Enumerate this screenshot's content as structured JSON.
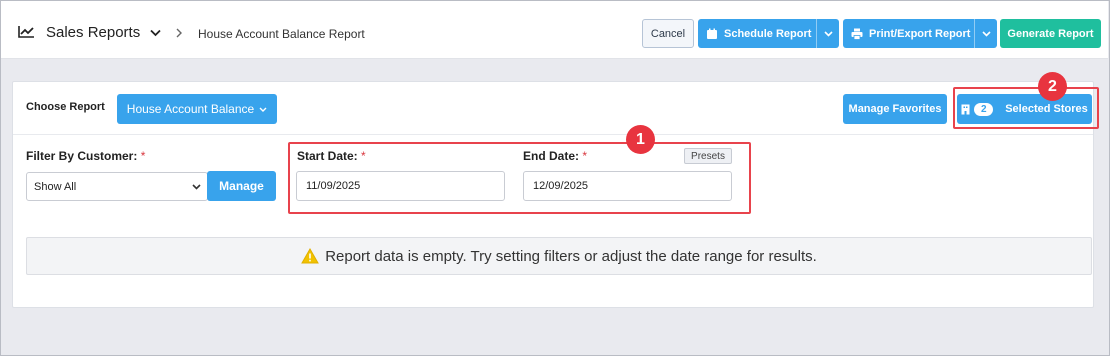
{
  "header": {
    "app_title": "Sales Reports",
    "breadcrumb_current": "House Account Balance Report",
    "cancel_label": "Cancel",
    "schedule_label": "Schedule Report",
    "print_label": "Print/Export Report",
    "generate_label": "Generate Report"
  },
  "toolbar": {
    "choose_label": "Choose Report",
    "report_selected": "House Account Balance",
    "favorites_label": "Manage Favorites",
    "stores_count": "2",
    "stores_label": "Selected Stores"
  },
  "filters": {
    "customer_label": "Filter By Customer:",
    "customer_selected": "Show All",
    "manage_label": "Manage",
    "start_label": "Start Date:",
    "start_value": "11/09/2025",
    "end_label": "End Date:",
    "end_value": "12/09/2025",
    "presets_label": "Presets",
    "required_mark": "*"
  },
  "annotations": {
    "callout_1": "1",
    "callout_2": "2"
  },
  "alert": {
    "message": "Report data is empty. Try setting filters or adjust the date range for results."
  },
  "colors": {
    "primary": "#38a3ec",
    "success": "#1fbf9e",
    "highlight": "#e8434c",
    "warning": "#f2c200"
  },
  "icons": [
    "chart-line-icon",
    "chevron-down-icon",
    "chevron-right-icon",
    "calendar-icon",
    "printer-icon",
    "store-icon",
    "warning-icon"
  ]
}
